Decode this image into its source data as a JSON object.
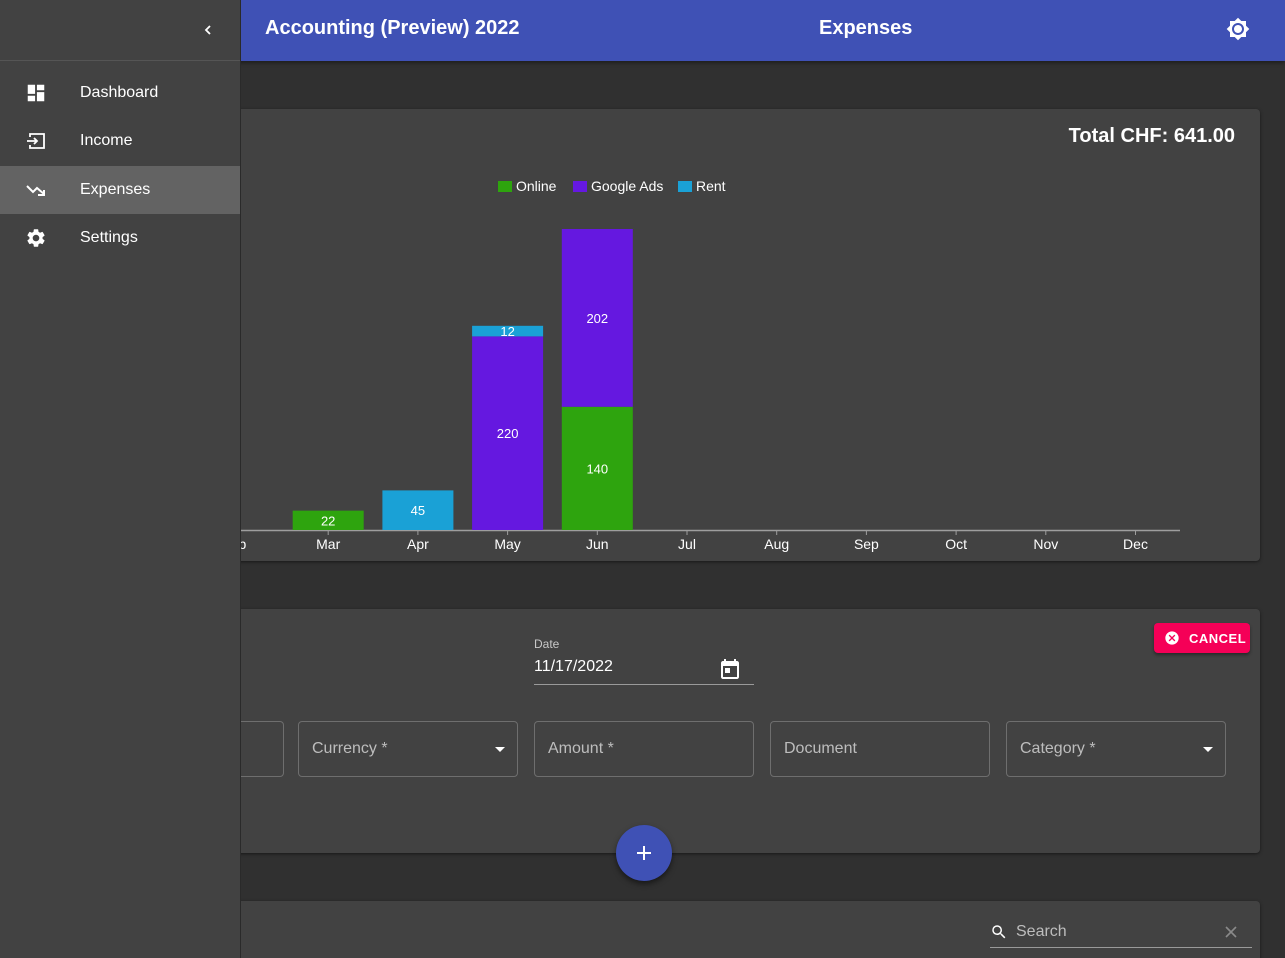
{
  "header": {
    "app_title": "Accounting (Preview) 2022",
    "page_title": "Expenses",
    "theme_icon": "brightness-icon"
  },
  "drawer": {
    "collapse_icon": "chevron-left-icon",
    "items": [
      {
        "label": "Dashboard",
        "icon": "dashboard-icon",
        "active": false
      },
      {
        "label": "Income",
        "icon": "income-icon",
        "active": false
      },
      {
        "label": "Expenses",
        "icon": "trending-down-icon",
        "active": true
      },
      {
        "label": "Settings",
        "icon": "gear-icon",
        "active": false
      }
    ]
  },
  "summary": {
    "total_text": "Total CHF: 641.00"
  },
  "chart_data": {
    "type": "bar",
    "stacked": true,
    "categories": [
      "Feb",
      "Mar",
      "Apr",
      "May",
      "Jun",
      "Jul",
      "Aug",
      "Sep",
      "Oct",
      "Nov",
      "Dec"
    ],
    "visible_category_labels": [
      "eb",
      "Mar",
      "Apr",
      "May",
      "Jun",
      "Jul",
      "Aug",
      "Sep",
      "Oct",
      "Nov",
      "Dec"
    ],
    "series": [
      {
        "name": "Online",
        "color": "#2ea40e",
        "values": [
          0,
          22,
          0,
          0,
          140,
          0,
          0,
          0,
          0,
          0,
          0
        ]
      },
      {
        "name": "Google Ads",
        "color": "#6518e0",
        "values": [
          0,
          0,
          0,
          220,
          202,
          0,
          0,
          0,
          0,
          0,
          0
        ]
      },
      {
        "name": "Rent",
        "color": "#1aa1d6",
        "values": [
          0,
          0,
          45,
          12,
          0,
          0,
          0,
          0,
          0,
          0,
          0
        ]
      }
    ],
    "legend_position": "top",
    "grid": false,
    "ylim": [
      0,
      342
    ]
  },
  "form": {
    "date_label": "Date",
    "date_value": "11/17/2022",
    "cancel_label": "CANCEL",
    "fields": {
      "currency": "Currency *",
      "amount": "Amount *",
      "document": "Document",
      "category": "Category *"
    },
    "add_icon": "plus-icon"
  },
  "table": {
    "search_placeholder": "Search"
  },
  "colors": {
    "primary": "#3f51b5",
    "accent": "#f50057",
    "background": "#303030",
    "card": "#424242"
  }
}
